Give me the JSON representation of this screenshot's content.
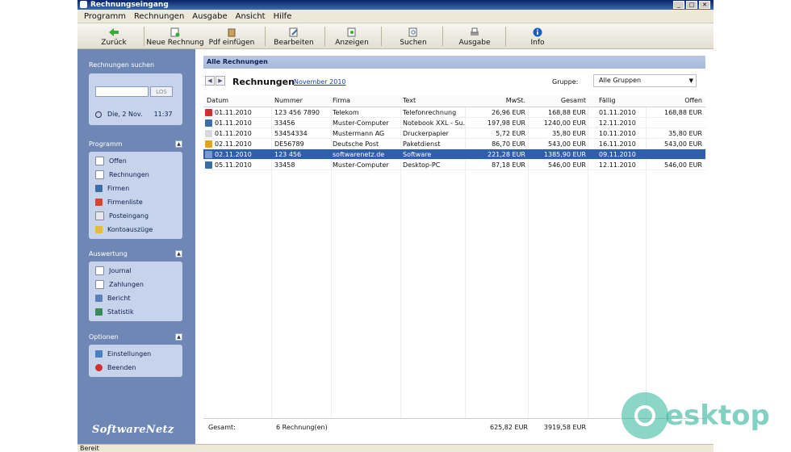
{
  "window": {
    "title": "Rechnungseingang"
  },
  "menu": [
    "Programm",
    "Rechnungen",
    "Ausgabe",
    "Ansicht",
    "Hilfe"
  ],
  "toolbar": {
    "back": "Zurück",
    "new_invoice": "Neue Rechnung",
    "pdf_insert": "Pdf einfügen",
    "edit": "Bearbeiten",
    "show": "Anzeigen",
    "search": "Suchen",
    "output": "Ausgabe",
    "info": "Info"
  },
  "sidebar": {
    "search_title": "Rechnungen suchen",
    "search_button": "LOS",
    "date": "Die, 2 Nov.",
    "time": "11:37",
    "program_title": "Programm",
    "program_items": [
      "Offen",
      "Rechnungen",
      "Firmen",
      "Firmenliste",
      "Posteingang",
      "Kontoauszüge"
    ],
    "evaluation_title": "Auswertung",
    "evaluation_items": [
      "Journal",
      "Zahlungen",
      "Bericht",
      "Statistik"
    ],
    "options_title": "Optionen",
    "options_items": [
      "Einstellungen",
      "Beenden"
    ],
    "logo": "SoftwareNetz"
  },
  "main": {
    "section_title": "Alle Rechnungen",
    "list_title": "Rechnungen",
    "period": "November 2010",
    "group_label": "Gruppe:",
    "group_value": "Alle Gruppen",
    "columns": [
      "Datum",
      "Nummer",
      "Firma",
      "Text",
      "MwSt.",
      "Gesamt",
      "Fällig",
      "Offen"
    ],
    "rows": [
      [
        "01.11.2010",
        "123 456 7890",
        "Telekom",
        "Telefonrechnung",
        "26,96 EUR",
        "168,88 EUR",
        "01.11.2010",
        "168,88 EUR"
      ],
      [
        "01.11.2010",
        "33456",
        "Muster-Computer",
        "Notebook XXL - Su...",
        "197,98 EUR",
        "1240,00 EUR",
        "12.11.2010",
        ""
      ],
      [
        "01.11.2010",
        "53454334",
        "Mustermann AG",
        "Druckerpapier",
        "5,72 EUR",
        "35,80 EUR",
        "10.11.2010",
        "35,80 EUR"
      ],
      [
        "02.11.2010",
        "DE56789",
        "Deutsche Post",
        "Paketdienst",
        "86,70 EUR",
        "543,00 EUR",
        "16.11.2010",
        "543,00 EUR"
      ],
      [
        "02.11.2010",
        "123 456",
        "softwarenetz.de",
        "Software",
        "221,28 EUR",
        "1385,90 EUR",
        "09.11.2010",
        ""
      ],
      [
        "05.11.2010",
        "33458",
        "Muster-Computer",
        "Desktop-PC",
        "87,18 EUR",
        "546,00 EUR",
        "12.11.2010",
        "546,00 EUR"
      ]
    ],
    "selected_row": 4,
    "footer": {
      "label": "Gesamt:",
      "count": "6 Rechnung(en)",
      "mwst": "625,82 EUR",
      "total": "3919,58 EUR"
    }
  },
  "status": "Bereit",
  "watermark": "esktop",
  "colors": {
    "sidebar": "#6f87b5",
    "panel": "#c6d3ea",
    "selection": "#2f5fa7",
    "accent": "#2fb59a"
  }
}
